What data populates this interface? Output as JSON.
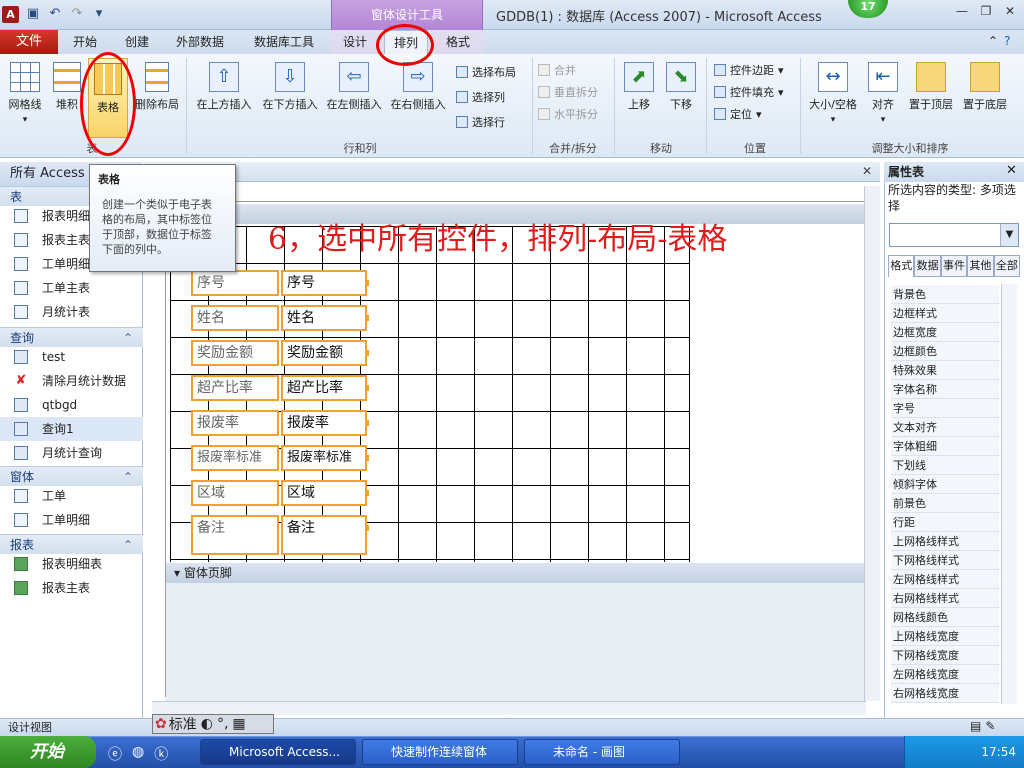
{
  "titlebar": {
    "context_group": "窗体设计工具",
    "window_title": "GDDB(1) : 数据库 (Access 2007)  -  Microsoft Access",
    "badge": "17",
    "app_icon": "A"
  },
  "tabs": {
    "file": "文件",
    "items": [
      "开始",
      "创建",
      "外部数据",
      "数据库工具",
      "设计",
      "排列",
      "格式"
    ],
    "selected": "排列"
  },
  "ribbon": {
    "table_group": {
      "buttons": [
        "网格线",
        "堆积",
        "表格",
        "删除布局"
      ],
      "label": "表"
    },
    "rows_cols_group": {
      "buttons": [
        "在上方插入",
        "在下方插入",
        "在左侧插入",
        "在右侧插入"
      ],
      "small": [
        "选择布局",
        "选择列",
        "选择行"
      ],
      "label": "行和列"
    },
    "merge_group": {
      "small": [
        "合并",
        "垂直拆分",
        "水平拆分"
      ],
      "label": "合并/拆分"
    },
    "move_group": {
      "buttons": [
        "上移",
        "下移"
      ],
      "label": "移动"
    },
    "position_group": {
      "small": [
        "控件边距",
        "控件填充",
        "定位"
      ],
      "label": "位置"
    },
    "size_group": {
      "buttons": [
        "大小/空格",
        "对齐",
        "置于顶层",
        "置于底层"
      ],
      "label": "调整大小和排序"
    }
  },
  "tooltip": {
    "title": "表格",
    "lines": [
      "创建一个类似于电子表",
      "格的布局，其中标签位",
      "于顶部，数据位于标签",
      "下面的列中。"
    ]
  },
  "nav": {
    "header": "所有 Access",
    "sections": [
      {
        "title": "表",
        "items": [
          "报表明细",
          "报表主表",
          "工单明细",
          "工单主表",
          "月统计表"
        ]
      },
      {
        "title": "查询",
        "items": [
          "test",
          "清除月统计数据",
          "qtbgd",
          "查询1",
          "月统计查询"
        ]
      },
      {
        "title": "窗体",
        "items": [
          "工单",
          "工单明细"
        ]
      },
      {
        "title": "报表",
        "items": [
          "报表明细表",
          "报表主表"
        ]
      }
    ]
  },
  "design": {
    "annotation": "6，选中所有控件，排列-布局-表格",
    "footer_band": "窗体页脚",
    "fields": [
      "序号",
      "姓名",
      "奖励金额",
      "超产比率",
      "报废率",
      "报废率标准",
      "区域",
      "备注"
    ]
  },
  "props": {
    "title": "属性表",
    "selection_type": "所选内容的类型:  多项选择",
    "tabs": [
      "格式",
      "数据",
      "事件",
      "其他",
      "全部"
    ],
    "rows": [
      "背景色",
      "边框样式",
      "边框宽度",
      "边框颜色",
      "特殊效果",
      "字体名称",
      "字号",
      "文本对齐",
      "字体粗细",
      "下划线",
      "倾斜字体",
      "前景色",
      "行距",
      "上网格线样式",
      "下网格线样式",
      "左网格线样式",
      "右网格线样式",
      "网格线颜色",
      "上网格线宽度",
      "下网格线宽度",
      "左网格线宽度",
      "右网格线宽度"
    ]
  },
  "status": {
    "view": "设计视图",
    "ime": "标准"
  },
  "taskbar": {
    "start": "开始",
    "items": [
      "Microsoft Access...",
      "快速制作连续窗体",
      "未命名 - 画图"
    ],
    "clock": "17:54"
  },
  "colors": {
    "annotation": "#e01c1c",
    "selection_border": "#f0a030",
    "file_tab": "#c1281c"
  }
}
